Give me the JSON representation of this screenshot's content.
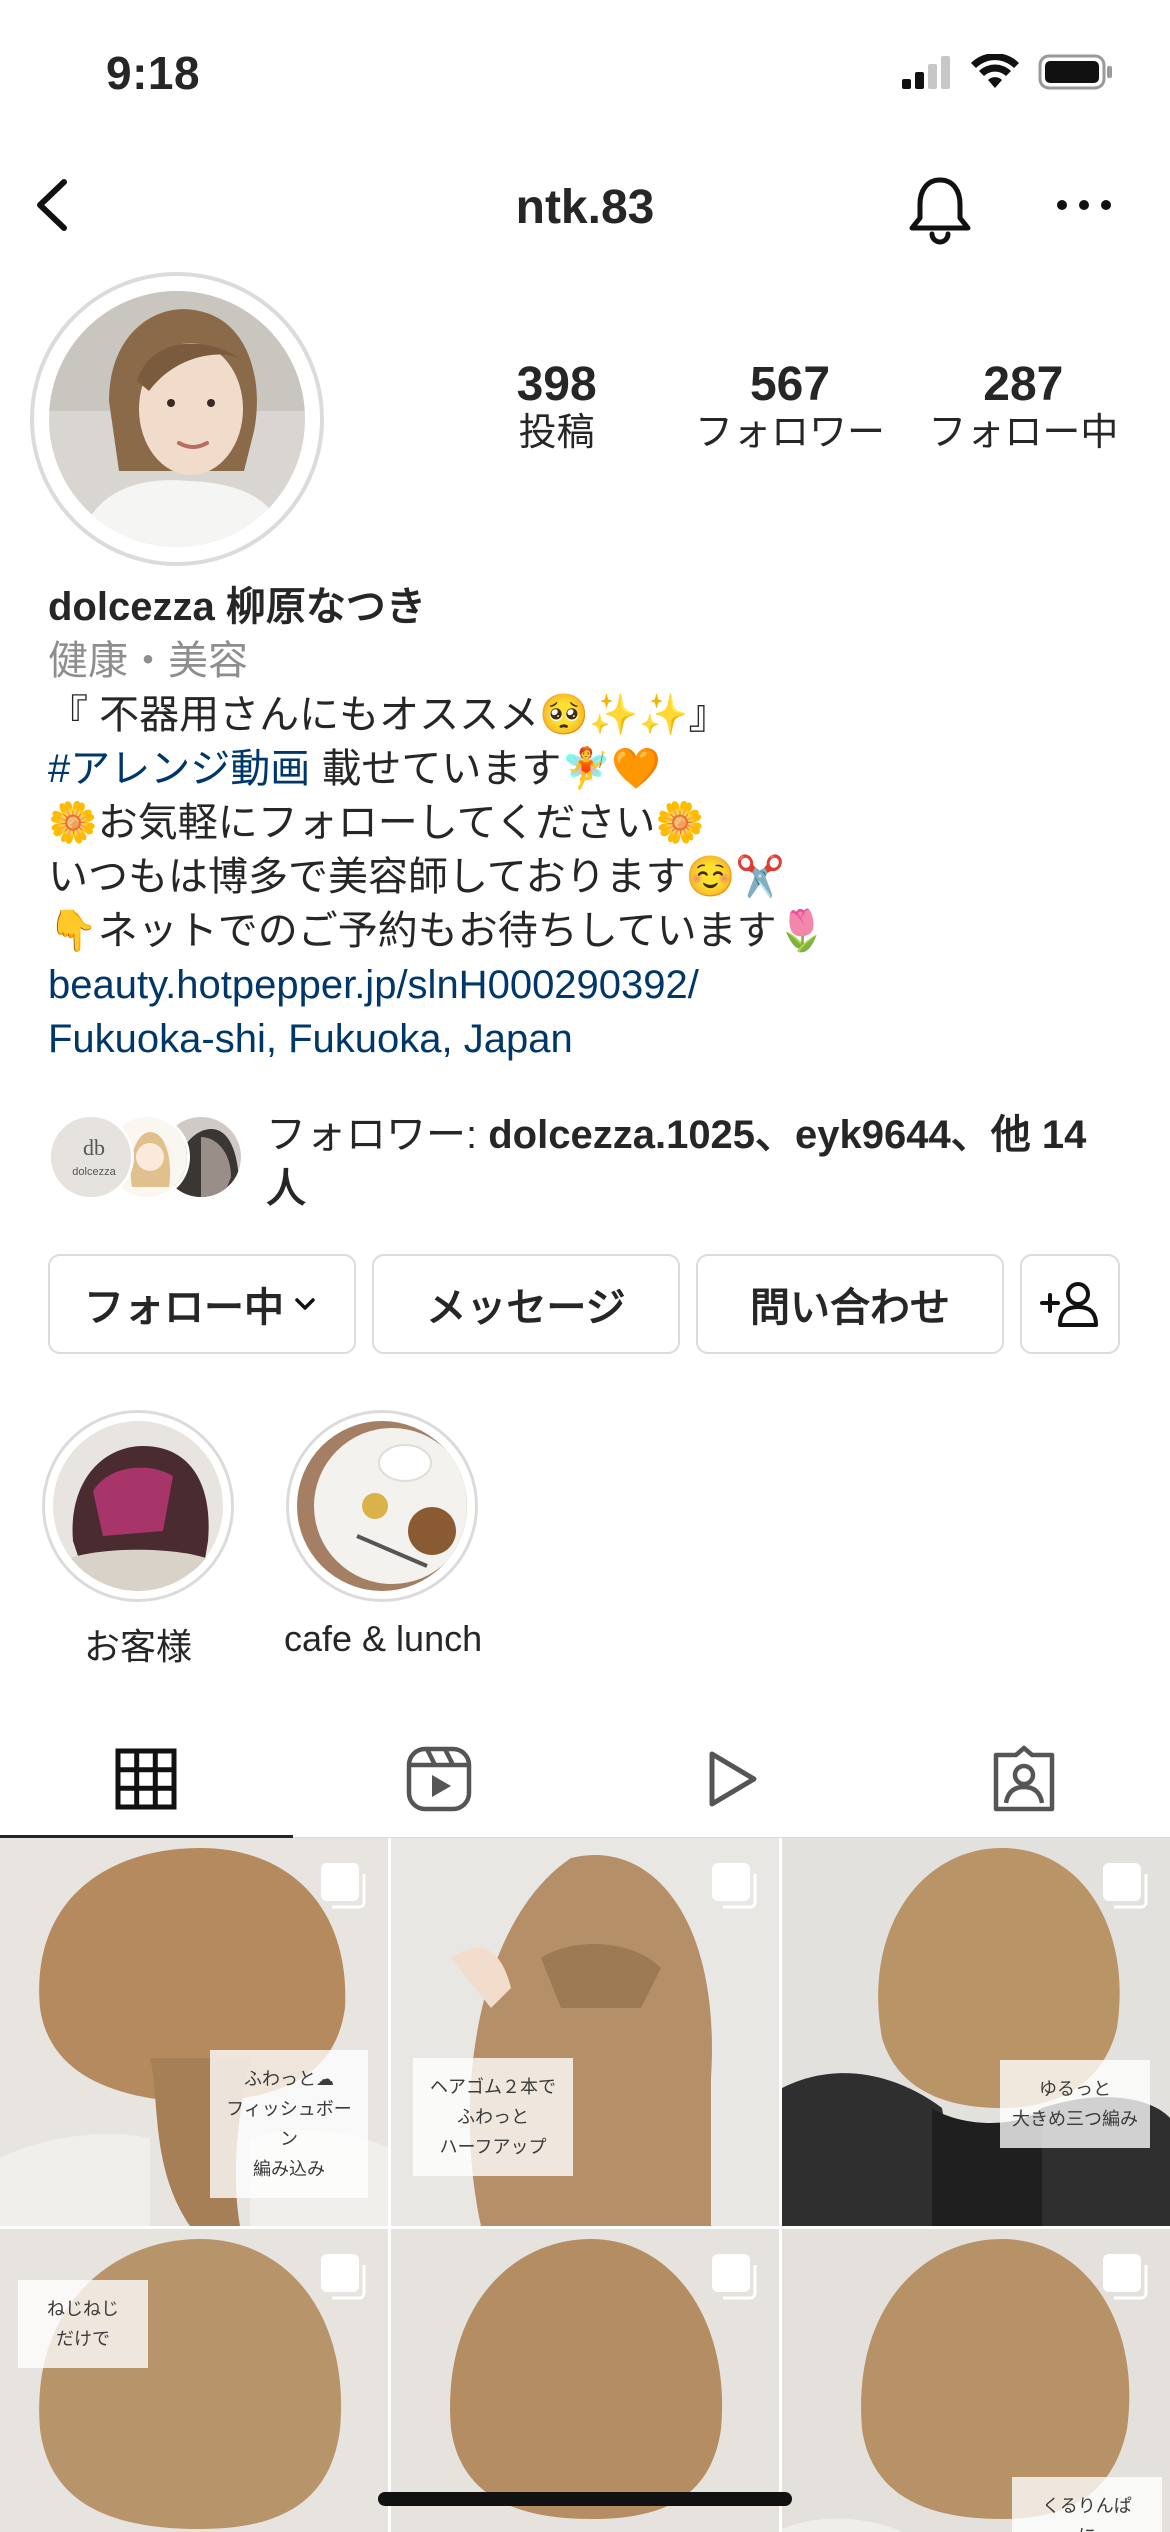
{
  "status_bar": {
    "time": "9:18"
  },
  "header": {
    "username": "ntk.83"
  },
  "stats": [
    {
      "value": "398",
      "label": "投稿"
    },
    {
      "value": "567",
      "label": "フォロワー"
    },
    {
      "value": "287",
      "label": "フォロー中"
    }
  ],
  "bio": {
    "name": "dolcezza  柳原なつき",
    "category": "健康・美容",
    "line1": "『 不器用さんにもオススメ🥺✨✨』",
    "line2_tag": "#アレンジ動画",
    "line2_rest": "  載せています🧚🧡",
    "line3": "🌼お気軽にフォローしてください🌼",
    "line4": "いつもは博多で美容師しております☺️✂️",
    "line5": "👇ネットでのご予約もお待ちしています🌷",
    "link": "beauty.hotpepper.jp/slnH000290392/",
    "location": "Fukuoka-shi, Fukuoka, Japan"
  },
  "followed_by": {
    "prefix": "フォロワー: ",
    "names": "dolcezza.1025、eyk9644",
    "suffix": "、他 14 人",
    "avatar_logo_text": "dolcezza"
  },
  "actions": {
    "follow": "フォロー中",
    "message": "メッセージ",
    "contact": "問い合わせ"
  },
  "highlights": [
    {
      "label": "お客様"
    },
    {
      "label": "cafe & lunch"
    }
  ],
  "tabs": [
    "posts-grid",
    "reels",
    "videos",
    "tagged"
  ],
  "grid": [
    {
      "caption": [
        "ふわっと☁",
        "フィッシュボーン",
        "編み込み"
      ]
    },
    {
      "caption": [
        "ヘアゴム２本で",
        "ふわっと",
        "ハーフアップ"
      ]
    },
    {
      "caption": [
        "ゆるっと",
        "大きめ三つ編み"
      ]
    },
    {
      "caption": []
    },
    {
      "caption": [
        "ねじねじ",
        "だけで"
      ]
    },
    {
      "caption": [
        "くるりんぱ",
        "に"
      ]
    }
  ],
  "colors": {
    "link": "#00376b",
    "border": "#dbdbdb",
    "muted": "#8e8e8e",
    "text": "#262626"
  }
}
